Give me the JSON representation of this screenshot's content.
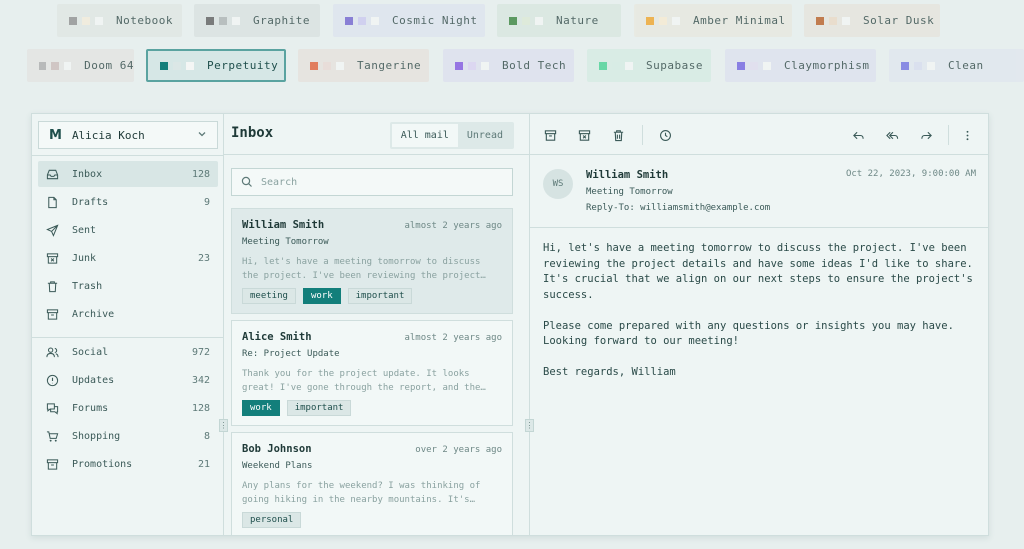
{
  "themes_row1": [
    {
      "label": "Notebook",
      "colors": [
        "#8a8a8a",
        "#f3ecd9"
      ],
      "bg": "#dfe6e2"
    },
    {
      "label": "Graphite",
      "colors": [
        "#555555",
        "#a9b0b0"
      ],
      "bg": "#d9e1e0"
    },
    {
      "label": "Cosmic Night",
      "colors": [
        "#6a5acd",
        "#c9c6f0"
      ],
      "bg": "#dde3ee"
    },
    {
      "label": "Nature",
      "colors": [
        "#2e7d32",
        "#dbe9d4"
      ],
      "bg": "#d8e6df"
    },
    {
      "label": "Amber Minimal",
      "colors": [
        "#f0a020",
        "#f7ead0"
      ],
      "bg": "#e8e8df"
    },
    {
      "label": "Solar Dusk",
      "colors": [
        "#b5561a",
        "#ead8c2"
      ],
      "bg": "#e6e3dc"
    }
  ],
  "themes_row2": [
    {
      "label": "Doom 64",
      "colors": [
        "#a9a9a9",
        "#c9b9b6"
      ],
      "bg": "#e3e3e1"
    },
    {
      "label": "Perpetuity",
      "colors": [
        "#137f7b",
        "#dbe7e6"
      ],
      "bg": "#d6e7e6"
    },
    {
      "label": "Tangerine",
      "colors": [
        "#e0572e",
        "#e9d8d3"
      ],
      "bg": "#e6e1dc"
    },
    {
      "label": "Bold Tech",
      "colors": [
        "#7b4de0",
        "#d9d0f2"
      ],
      "bg": "#dde0ee"
    },
    {
      "label": "Supabase",
      "colors": [
        "#3ecf8e",
        "#d4ece2"
      ],
      "bg": "#d5ebe2"
    },
    {
      "label": "Claymorphism",
      "colors": [
        "#6a5ae0",
        "#e0dcef"
      ],
      "bg": "#dde1ee"
    },
    {
      "label": "Clean",
      "colors": [
        "#6a6ae0",
        "#d6dbef"
      ],
      "bg": "#e0e6ee"
    }
  ],
  "account": {
    "name": "Alicia Koch",
    "logo": "M"
  },
  "nav_primary": [
    {
      "label": "Inbox",
      "count": "128",
      "icon": "inbox-icon"
    },
    {
      "label": "Drafts",
      "count": "9",
      "icon": "file-icon"
    },
    {
      "label": "Sent",
      "count": "",
      "icon": "send-icon"
    },
    {
      "label": "Junk",
      "count": "23",
      "icon": "archive-x-icon"
    },
    {
      "label": "Trash",
      "count": "",
      "icon": "trash-icon"
    },
    {
      "label": "Archive",
      "count": "",
      "icon": "archive-icon"
    }
  ],
  "nav_secondary": [
    {
      "label": "Social",
      "count": "972",
      "icon": "users-icon"
    },
    {
      "label": "Updates",
      "count": "342",
      "icon": "alert-circle-icon"
    },
    {
      "label": "Forums",
      "count": "128",
      "icon": "messages-icon"
    },
    {
      "label": "Shopping",
      "count": "8",
      "icon": "cart-icon"
    },
    {
      "label": "Promotions",
      "count": "21",
      "icon": "archive-icon"
    }
  ],
  "list": {
    "title": "Inbox",
    "tabs": [
      "All mail",
      "Unread"
    ],
    "search_placeholder": "Search"
  },
  "mails": [
    {
      "from": "William Smith",
      "when": "almost 2 years ago",
      "subject": "Meeting Tomorrow",
      "preview": "Hi, let's have a meeting tomorrow to discuss the project. I've been reviewing the project…",
      "tags": [
        {
          "label": "meeting",
          "primary": false
        },
        {
          "label": "work",
          "primary": true
        },
        {
          "label": "important",
          "primary": false
        }
      ]
    },
    {
      "from": "Alice Smith",
      "when": "almost 2 years ago",
      "subject": "Re: Project Update",
      "preview": "Thank you for the project update. It looks great! I've gone through the report, and the…",
      "tags": [
        {
          "label": "work",
          "primary": true
        },
        {
          "label": "important",
          "primary": false
        }
      ]
    },
    {
      "from": "Bob Johnson",
      "when": "over 2 years ago",
      "subject": "Weekend Plans",
      "preview": "Any plans for the weekend? I was thinking of going hiking in the nearby mountains. It's…",
      "tags": [
        {
          "label": "personal",
          "primary": false
        }
      ]
    }
  ],
  "message": {
    "initials": "WS",
    "sender": "William Smith",
    "subject": "Meeting Tomorrow",
    "reply_to": "Reply-To: williamsmith@example.com",
    "date": "Oct 22, 2023, 9:00:00 AM",
    "body": [
      "Hi, let's have a meeting tomorrow to discuss the project. I've been reviewing the project details and have some ideas I'd like to share. It's crucial that we align on our next steps to ensure the project's success.",
      "Please come prepared with any questions or insights you may have. Looking forward to our meeting!",
      "Best regards, William"
    ]
  },
  "accent": "#137f7b"
}
